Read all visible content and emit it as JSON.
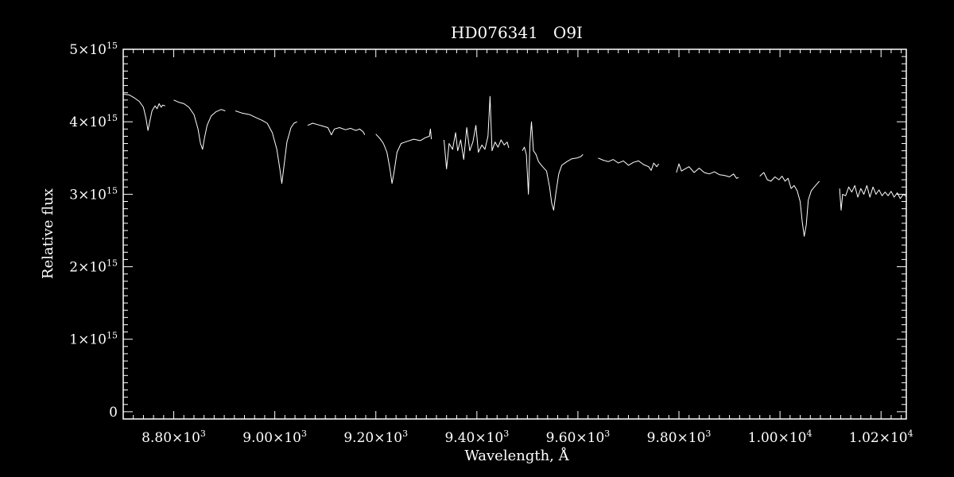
{
  "chart_data": {
    "type": "line",
    "title": "HD076341   O9I",
    "xlabel": "Wavelength, Å",
    "ylabel": "Relative flux",
    "xlim": [
      8700,
      10250
    ],
    "ylim": [
      -100000000000000.0,
      5000000000000000.0
    ],
    "x_ticks": [
      {
        "value": 8800,
        "mantissa": "8.80",
        "exp": "3"
      },
      {
        "value": 9000,
        "mantissa": "9.00",
        "exp": "3"
      },
      {
        "value": 9200,
        "mantissa": "9.20",
        "exp": "3"
      },
      {
        "value": 9400,
        "mantissa": "9.40",
        "exp": "3"
      },
      {
        "value": 9600,
        "mantissa": "9.60",
        "exp": "3"
      },
      {
        "value": 9800,
        "mantissa": "9.80",
        "exp": "3"
      },
      {
        "value": 10000,
        "mantissa": "1.00",
        "exp": "4"
      },
      {
        "value": 10200,
        "mantissa": "1.02",
        "exp": "4"
      }
    ],
    "y_ticks": [
      {
        "value": 0,
        "mantissa": "0",
        "exp": ""
      },
      {
        "value": 1000000000000000.0,
        "mantissa": "1",
        "exp": "15"
      },
      {
        "value": 2000000000000000.0,
        "mantissa": "2",
        "exp": "15"
      },
      {
        "value": 3000000000000000.0,
        "mantissa": "3",
        "exp": "15"
      },
      {
        "value": 4000000000000000.0,
        "mantissa": "4",
        "exp": "15"
      },
      {
        "value": 5000000000000000.0,
        "mantissa": "5",
        "exp": "15"
      }
    ],
    "tick_times_sign": "×10",
    "series": [
      {
        "values": [
          [
            8700,
            4380000000000000.0
          ],
          [
            8712,
            4370000000000000.0
          ],
          [
            8722,
            4330000000000000.0
          ],
          [
            8732,
            4280000000000000.0
          ],
          [
            8740,
            4200000000000000.0
          ],
          [
            8745,
            4050000000000000.0
          ],
          [
            8749,
            3880000000000000.0
          ],
          [
            8753,
            4020000000000000.0
          ],
          [
            8757,
            4150000000000000.0
          ],
          [
            8763,
            4220000000000000.0
          ],
          [
            8767,
            4180000000000000.0
          ],
          [
            8771,
            4250000000000000.0
          ],
          [
            8775,
            4200000000000000.0
          ],
          [
            8778,
            4230000000000000.0
          ],
          [
            8783,
            4220000000000000.0
          ]
        ]
      },
      {
        "values": [
          [
            8800,
            4300000000000000.0
          ],
          [
            8810,
            4270000000000000.0
          ],
          [
            8820,
            4250000000000000.0
          ],
          [
            8830,
            4200000000000000.0
          ],
          [
            8840,
            4100000000000000.0
          ],
          [
            8848,
            3900000000000000.0
          ],
          [
            8853,
            3700000000000000.0
          ],
          [
            8857,
            3620000000000000.0
          ],
          [
            8861,
            3780000000000000.0
          ],
          [
            8866,
            3950000000000000.0
          ],
          [
            8874,
            4080000000000000.0
          ],
          [
            8884,
            4140000000000000.0
          ],
          [
            8894,
            4170000000000000.0
          ],
          [
            8902,
            4150000000000000.0
          ]
        ]
      },
      {
        "values": [
          [
            8922,
            4150000000000000.0
          ],
          [
            8935,
            4120000000000000.0
          ],
          [
            8950,
            4100000000000000.0
          ],
          [
            8962,
            4060000000000000.0
          ],
          [
            8975,
            4020000000000000.0
          ],
          [
            8985,
            3980000000000000.0
          ],
          [
            8995,
            3850000000000000.0
          ],
          [
            9004,
            3620000000000000.0
          ],
          [
            9010,
            3350000000000000.0
          ],
          [
            9014,
            3150000000000000.0
          ],
          [
            9018,
            3380000000000000.0
          ],
          [
            9024,
            3720000000000000.0
          ],
          [
            9032,
            3920000000000000.0
          ],
          [
            9038,
            3980000000000000.0
          ],
          [
            9044,
            4000000000000000.0
          ]
        ]
      },
      {
        "values": [
          [
            9065,
            3950000000000000.0
          ],
          [
            9075,
            3980000000000000.0
          ],
          [
            9085,
            3960000000000000.0
          ],
          [
            9095,
            3940000000000000.0
          ],
          [
            9105,
            3920000000000000.0
          ],
          [
            9112,
            3820000000000000.0
          ],
          [
            9118,
            3900000000000000.0
          ],
          [
            9128,
            3920000000000000.0
          ],
          [
            9140,
            3890000000000000.0
          ],
          [
            9150,
            3910000000000000.0
          ],
          [
            9160,
            3880000000000000.0
          ],
          [
            9168,
            3900000000000000.0
          ],
          [
            9175,
            3860000000000000.0
          ],
          [
            9178,
            3820000000000000.0
          ]
        ]
      },
      {
        "values": [
          [
            9200,
            3830000000000000.0
          ],
          [
            9208,
            3770000000000000.0
          ],
          [
            9215,
            3700000000000000.0
          ],
          [
            9222,
            3580000000000000.0
          ],
          [
            9228,
            3350000000000000.0
          ],
          [
            9232,
            3150000000000000.0
          ],
          [
            9236,
            3300000000000000.0
          ],
          [
            9242,
            3580000000000000.0
          ],
          [
            9250,
            3700000000000000.0
          ],
          [
            9262,
            3730000000000000.0
          ],
          [
            9275,
            3760000000000000.0
          ],
          [
            9288,
            3740000000000000.0
          ],
          [
            9298,
            3780000000000000.0
          ],
          [
            9306,
            3800000000000000.0
          ],
          [
            9308,
            3900000000000000.0
          ],
          [
            9310,
            3760000000000000.0
          ]
        ]
      },
      {
        "values": [
          [
            9335,
            3750000000000000.0
          ],
          [
            9340,
            3350000000000000.0
          ],
          [
            9345,
            3700000000000000.0
          ],
          [
            9352,
            3620000000000000.0
          ],
          [
            9358,
            3850000000000000.0
          ],
          [
            9362,
            3600000000000000.0
          ],
          [
            9368,
            3750000000000000.0
          ],
          [
            9374,
            3480000000000000.0
          ],
          [
            9380,
            3920000000000000.0
          ],
          [
            9386,
            3600000000000000.0
          ],
          [
            9392,
            3720000000000000.0
          ],
          [
            9398,
            3950000000000000.0
          ],
          [
            9403,
            3580000000000000.0
          ],
          [
            9410,
            3680000000000000.0
          ],
          [
            9416,
            3620000000000000.0
          ],
          [
            9422,
            3800000000000000.0
          ],
          [
            9426,
            4350000000000000.0
          ],
          [
            9430,
            3600000000000000.0
          ],
          [
            9436,
            3720000000000000.0
          ],
          [
            9442,
            3650000000000000.0
          ],
          [
            9448,
            3750000000000000.0
          ],
          [
            9454,
            3680000000000000.0
          ],
          [
            9460,
            3720000000000000.0
          ],
          [
            9463,
            3640000000000000.0
          ]
        ]
      },
      {
        "values": [
          [
            9490,
            3600000000000000.0
          ],
          [
            9494,
            3650000000000000.0
          ],
          [
            9498,
            3550000000000000.0
          ],
          [
            9502,
            3000000000000000.0
          ],
          [
            9505,
            3700000000000000.0
          ],
          [
            9508,
            4000000000000000.0
          ],
          [
            9512,
            3600000000000000.0
          ],
          [
            9517,
            3550000000000000.0
          ],
          [
            9522,
            3450000000000000.0
          ],
          [
            9530,
            3380000000000000.0
          ],
          [
            9538,
            3320000000000000.0
          ],
          [
            9544,
            3100000000000000.0
          ],
          [
            9548,
            2880000000000000.0
          ],
          [
            9552,
            2780000000000000.0
          ],
          [
            9556,
            3000000000000000.0
          ],
          [
            9562,
            3280000000000000.0
          ],
          [
            9568,
            3400000000000000.0
          ],
          [
            9578,
            3450000000000000.0
          ],
          [
            9588,
            3490000000000000.0
          ],
          [
            9598,
            3500000000000000.0
          ],
          [
            9606,
            3520000000000000.0
          ],
          [
            9610,
            3550000000000000.0
          ]
        ]
      },
      {
        "values": [
          [
            9640,
            3500000000000000.0
          ],
          [
            9650,
            3470000000000000.0
          ],
          [
            9660,
            3450000000000000.0
          ],
          [
            9670,
            3480000000000000.0
          ],
          [
            9680,
            3430000000000000.0
          ],
          [
            9690,
            3460000000000000.0
          ],
          [
            9700,
            3400000000000000.0
          ],
          [
            9710,
            3440000000000000.0
          ],
          [
            9720,
            3460000000000000.0
          ],
          [
            9730,
            3410000000000000.0
          ],
          [
            9740,
            3380000000000000.0
          ],
          [
            9745,
            3330000000000000.0
          ],
          [
            9750,
            3430000000000000.0
          ],
          [
            9756,
            3380000000000000.0
          ],
          [
            9760,
            3420000000000000.0
          ]
        ]
      },
      {
        "values": [
          [
            9795,
            3300000000000000.0
          ],
          [
            9800,
            3420000000000000.0
          ],
          [
            9805,
            3320000000000000.0
          ],
          [
            9812,
            3350000000000000.0
          ],
          [
            9820,
            3380000000000000.0
          ],
          [
            9830,
            3300000000000000.0
          ],
          [
            9840,
            3360000000000000.0
          ],
          [
            9850,
            3300000000000000.0
          ],
          [
            9860,
            3280000000000000.0
          ],
          [
            9870,
            3310000000000000.0
          ],
          [
            9880,
            3270000000000000.0
          ],
          [
            9890,
            3260000000000000.0
          ],
          [
            9900,
            3240000000000000.0
          ],
          [
            9908,
            3280000000000000.0
          ],
          [
            9914,
            3220000000000000.0
          ],
          [
            9918,
            3230000000000000.0
          ]
        ]
      },
      {
        "values": [
          [
            9960,
            3250000000000000.0
          ],
          [
            9968,
            3300000000000000.0
          ],
          [
            9975,
            3200000000000000.0
          ],
          [
            9982,
            3180000000000000.0
          ],
          [
            9990,
            3240000000000000.0
          ],
          [
            9998,
            3200000000000000.0
          ],
          [
            10004,
            3250000000000000.0
          ],
          [
            10010,
            3180000000000000.0
          ],
          [
            10016,
            3220000000000000.0
          ],
          [
            10022,
            3080000000000000.0
          ],
          [
            10028,
            3120000000000000.0
          ],
          [
            10034,
            3050000000000000.0
          ],
          [
            10040,
            2900000000000000.0
          ],
          [
            10044,
            2620000000000000.0
          ],
          [
            10048,
            2420000000000000.0
          ],
          [
            10052,
            2580000000000000.0
          ],
          [
            10056,
            2920000000000000.0
          ],
          [
            10062,
            3050000000000000.0
          ],
          [
            10068,
            3100000000000000.0
          ],
          [
            10074,
            3150000000000000.0
          ],
          [
            10078,
            3180000000000000.0
          ]
        ]
      },
      {
        "values": [
          [
            10118,
            3080000000000000.0
          ],
          [
            10121,
            2780000000000000.0
          ],
          [
            10124,
            3000000000000000.0
          ],
          [
            10130,
            2980000000000000.0
          ],
          [
            10136,
            3100000000000000.0
          ],
          [
            10142,
            3030000000000000.0
          ],
          [
            10148,
            3120000000000000.0
          ],
          [
            10154,
            2960000000000000.0
          ],
          [
            10160,
            3080000000000000.0
          ],
          [
            10166,
            3000000000000000.0
          ],
          [
            10172,
            3120000000000000.0
          ],
          [
            10178,
            2960000000000000.0
          ],
          [
            10184,
            3100000000000000.0
          ],
          [
            10190,
            3000000000000000.0
          ],
          [
            10196,
            3060000000000000.0
          ],
          [
            10202,
            2980000000000000.0
          ],
          [
            10208,
            3030000000000000.0
          ],
          [
            10214,
            2980000000000000.0
          ],
          [
            10220,
            3040000000000000.0
          ],
          [
            10226,
            2960000000000000.0
          ],
          [
            10232,
            3020000000000000.0
          ],
          [
            10238,
            2940000000000000.0
          ],
          [
            10244,
            3000000000000000.0
          ],
          [
            10250,
            2970000000000000.0
          ]
        ]
      }
    ]
  }
}
